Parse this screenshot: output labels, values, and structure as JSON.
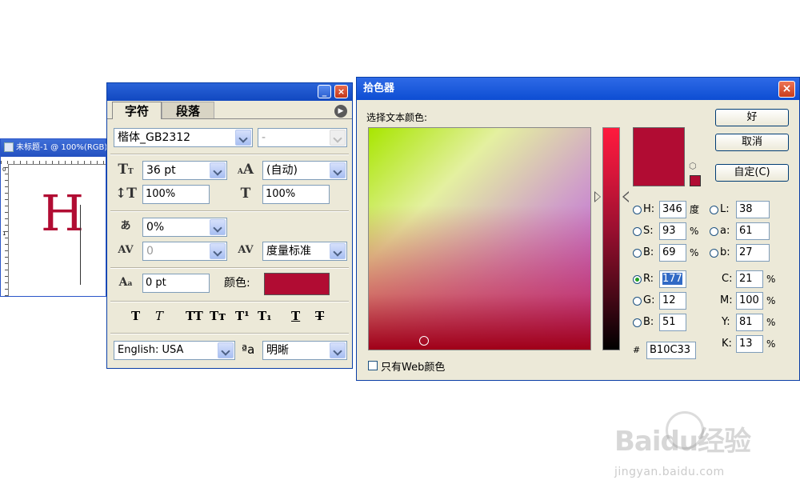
{
  "document": {
    "title": "未标题-1 @ 100%(RGB)",
    "ruler_tick_0": "0",
    "ruler_tick_1": "1",
    "canvas_text": "H",
    "text_color": "#b10c33"
  },
  "char_panel": {
    "tabs": [
      "字符",
      "段落"
    ],
    "font_family": "楷体_GB2312",
    "font_style": "-",
    "font_size": "36 pt",
    "leading": "(自动)",
    "vertical_scale": "100%",
    "horizontal_scale": "100%",
    "tsume": "0%",
    "kerning": "0",
    "tracking": "度量标准",
    "baseline_shift": "0 pt",
    "color_label": "颜色:",
    "color_value": "#b10c33",
    "language": "English: USA",
    "anti_alias_label": "ªa",
    "anti_alias": "明晰",
    "style_buttons": [
      "T",
      "T",
      "TT",
      "Tт",
      "T¹",
      "T₁",
      "T",
      "T"
    ]
  },
  "color_picker": {
    "title": "拾色器",
    "prompt": "选择文本颜色:",
    "buttons": {
      "ok": "好",
      "cancel": "取消",
      "custom": "自定(C)"
    },
    "hsb": [
      {
        "label": "H:",
        "value": "346",
        "unit": "度",
        "selected": false
      },
      {
        "label": "S:",
        "value": "93",
        "unit": "%",
        "selected": false
      },
      {
        "label": "B:",
        "value": "69",
        "unit": "%",
        "selected": false
      }
    ],
    "rgb": [
      {
        "label": "R:",
        "value": "177",
        "selected": true
      },
      {
        "label": "G:",
        "value": "12",
        "selected": false
      },
      {
        "label": "B:",
        "value": "51",
        "selected": false
      }
    ],
    "lab": [
      {
        "label": "L:",
        "value": "38"
      },
      {
        "label": "a:",
        "value": "61"
      },
      {
        "label": "b:",
        "value": "27"
      }
    ],
    "cmyk": [
      {
        "label": "C:",
        "value": "21",
        "unit": "%"
      },
      {
        "label": "M:",
        "value": "100",
        "unit": "%"
      },
      {
        "label": "Y:",
        "value": "81",
        "unit": "%"
      },
      {
        "label": "K:",
        "value": "13",
        "unit": "%"
      }
    ],
    "hex_label": "#",
    "hex_value": "B10C33",
    "current_color": "#b10c33",
    "web_only_label": "只有Web颜色",
    "web_only_checked": false
  },
  "watermark": {
    "logo": "Baidu经验",
    "url": "jingyan.baidu.com"
  }
}
